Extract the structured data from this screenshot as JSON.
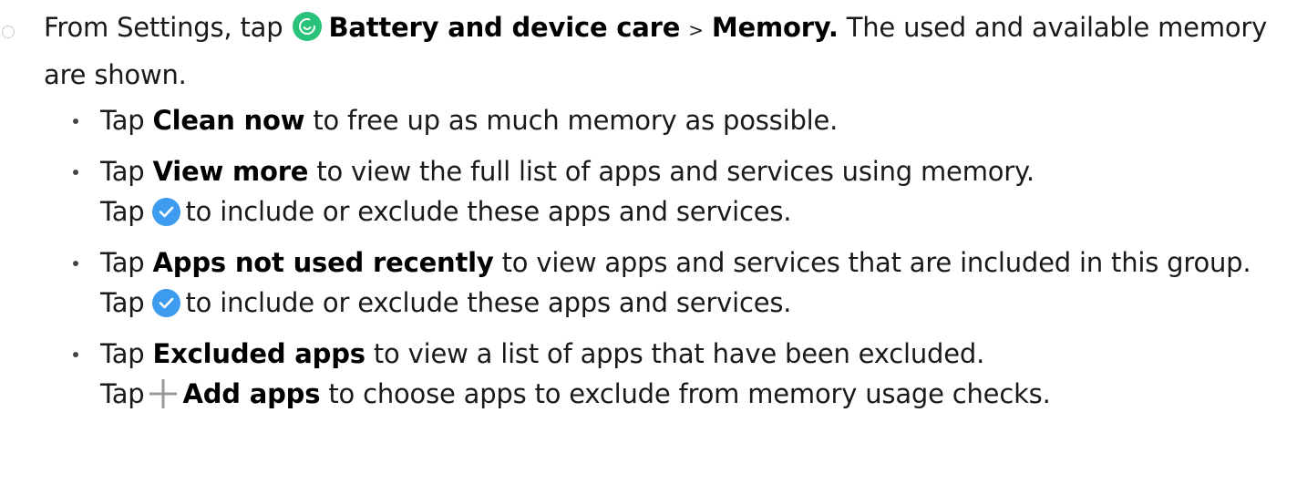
{
  "step": {
    "prefix": "From Settings, tap",
    "battery_label": "Battery and device care",
    "separator": ">",
    "memory_label": "Memory.",
    "suffix": "The used and available memory are shown."
  },
  "bullets": [
    {
      "pre": "Tap",
      "bold": "Clean now",
      "post": "to free up as much memory as possible."
    },
    {
      "pre": "Tap",
      "bold": "View more",
      "post": "to view the full list of apps and services using memory.",
      "tap": "Tap",
      "post2": "to include or exclude these apps and services."
    },
    {
      "pre": "Tap",
      "bold": "Apps not used recently",
      "post": "to view apps and services that are included in this group. Tap",
      "post2": "to include or exclude these apps and services."
    },
    {
      "pre": "Tap",
      "bold": "Excluded apps",
      "post": "to view a list of apps that have been excluded.",
      "tap": "Tap",
      "bold2": "Add apps",
      "post2": "to choose apps to exclude from memory usage checks."
    }
  ],
  "colors": {
    "settings_icon": "#29c27a",
    "check_icon": "#3d9bf0",
    "plus_icon": "#9a9a9a"
  }
}
